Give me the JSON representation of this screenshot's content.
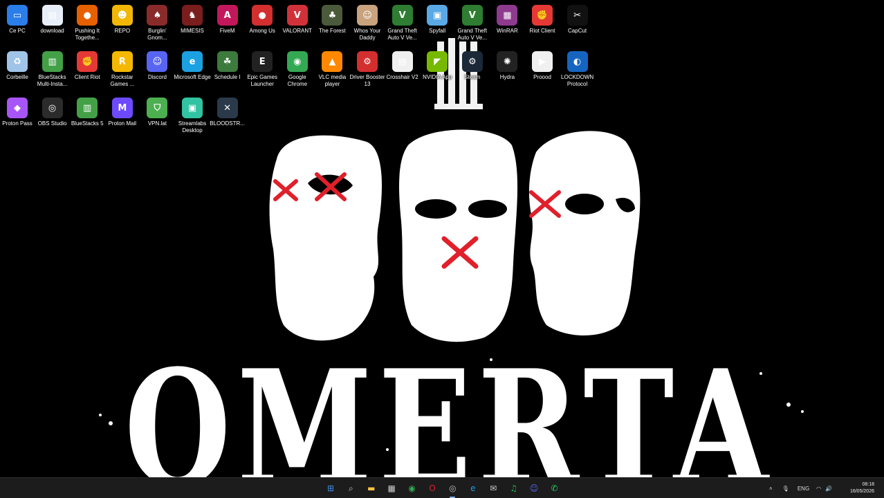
{
  "desktop": {
    "icons": [
      {
        "label": "Ce PC",
        "icon": "monitor-icon",
        "color": "#2b7de9",
        "glyph": "▭"
      },
      {
        "label": "download",
        "icon": "file-icon",
        "color": "#e8eef8",
        "glyph": "▤"
      },
      {
        "label": "Pushing It Togethe...",
        "icon": "firefox-icon",
        "color": "#e66000",
        "glyph": "●"
      },
      {
        "label": "REPO",
        "icon": "repo-icon",
        "color": "#f2b705",
        "glyph": "☻"
      },
      {
        "label": "Burglin' Gnom...",
        "icon": "gnome-icon",
        "color": "#8a2b2b",
        "glyph": "♠"
      },
      {
        "label": "MIMESIS",
        "icon": "mimesis-icon",
        "color": "#7a1d1d",
        "glyph": "♞"
      },
      {
        "label": "FiveM",
        "icon": "fivem-icon",
        "color": "#c2185b",
        "glyph": "A"
      },
      {
        "label": "Among Us",
        "icon": "among-us-icon",
        "color": "#d32f2f",
        "glyph": "●"
      },
      {
        "label": "VALORANT",
        "icon": "valorant-icon",
        "color": "#d13239",
        "glyph": "V"
      },
      {
        "label": "The Forest",
        "icon": "forest-icon",
        "color": "#4a5a3a",
        "glyph": "♣"
      },
      {
        "label": "Whos Your Daddy",
        "icon": "whos-your-daddy-icon",
        "color": "#c9a27e",
        "glyph": "☺"
      },
      {
        "label": "Grand Theft Auto V Ve...",
        "icon": "gta-icon",
        "color": "#2e7d32",
        "glyph": "V"
      },
      {
        "label": "Spyfall",
        "icon": "spyfall-icon",
        "color": "#5aa9e6",
        "glyph": "▣"
      },
      {
        "label": "Grand Theft Auto V Ve...",
        "icon": "gta-icon",
        "color": "#2e7d32",
        "glyph": "V"
      },
      {
        "label": "WinRAR",
        "icon": "winrar-icon",
        "color": "#8e3a8e",
        "glyph": "▦"
      },
      {
        "label": "Riot Client",
        "icon": "riot-client-icon",
        "color": "#e53935",
        "glyph": "✊"
      },
      {
        "label": "CapCut",
        "icon": "capcut-icon",
        "color": "#111111",
        "glyph": "✂"
      },
      {
        "label": "Corbeille",
        "icon": "recycle-bin-icon",
        "color": "#9fc4e8",
        "glyph": "♻"
      },
      {
        "label": "BlueStacks Multi-Insta...",
        "icon": "bluestacks-multi-icon",
        "color": "#43a047",
        "glyph": "▥"
      },
      {
        "label": "Client Riot",
        "icon": "riot-client-icon",
        "color": "#e53935",
        "glyph": "✊"
      },
      {
        "label": "Rockstar Games ...",
        "icon": "rockstar-icon",
        "color": "#f5b800",
        "glyph": "R"
      },
      {
        "label": "Discord",
        "icon": "discord-icon",
        "color": "#5865f2",
        "glyph": "☺"
      },
      {
        "label": "Microsoft Edge",
        "icon": "edge-icon",
        "color": "#1ba1e2",
        "glyph": "e"
      },
      {
        "label": "Schedule I",
        "icon": "schedule-icon",
        "color": "#3d7a3d",
        "glyph": "☘"
      },
      {
        "label": "Epic Games Launcher",
        "icon": "epic-games-icon",
        "color": "#222222",
        "glyph": "E"
      },
      {
        "label": "Google Chrome",
        "icon": "chrome-icon",
        "color": "#34a853",
        "glyph": "◉"
      },
      {
        "label": "VLC media player",
        "icon": "vlc-icon",
        "color": "#ff8800",
        "glyph": "▲"
      },
      {
        "label": "Driver Booster 13",
        "icon": "driver-booster-icon",
        "color": "#d32f2f",
        "glyph": "⚙"
      },
      {
        "label": "Crosshair V2",
        "icon": "file-icon",
        "color": "#f0f0f0",
        "glyph": "▤"
      },
      {
        "label": "NVIDIA App",
        "icon": "nvidia-icon",
        "color": "#76b900",
        "glyph": "◤"
      },
      {
        "label": "Steam",
        "icon": "steam-icon",
        "color": "#1b2838",
        "glyph": "⚙"
      },
      {
        "label": "Hydra",
        "icon": "hydra-icon",
        "color": "#222222",
        "glyph": "✺"
      },
      {
        "label": "Proood",
        "icon": "file-icon",
        "color": "#f0f0f0",
        "glyph": "▶"
      },
      {
        "label": "LOCKDOWN Protocol",
        "icon": "lockdown-icon",
        "color": "#1565c0",
        "glyph": "◐"
      },
      {
        "label": "Proton Pass",
        "icon": "proton-pass-icon",
        "color": "#a855f7",
        "glyph": "◆"
      },
      {
        "label": "OBS Studio",
        "icon": "obs-icon",
        "color": "#2b2b2b",
        "glyph": "◎"
      },
      {
        "label": "BlueStacks 5",
        "icon": "bluestacks-icon",
        "color": "#43a047",
        "glyph": "▥"
      },
      {
        "label": "Proton Mail",
        "icon": "proton-mail-icon",
        "color": "#6d4aff",
        "glyph": "M"
      },
      {
        "label": "VPN.lat",
        "icon": "vpn-icon",
        "color": "#4caf50",
        "glyph": "⛉"
      },
      {
        "label": "Streamlabs Desktop",
        "icon": "streamlabs-icon",
        "color": "#31c3a2",
        "glyph": "▣"
      },
      {
        "label": "BLOODSTR...",
        "icon": "bloodstrike-icon",
        "color": "#2a3a4a",
        "glyph": "✕"
      }
    ]
  },
  "wallpaper": {
    "text": "OMERTA",
    "accent": "#e0202a"
  },
  "taskbar": {
    "apps": [
      {
        "icon": "windows-start-icon",
        "color": "#3b8eea",
        "glyph": "⊞",
        "label": "Start"
      },
      {
        "icon": "search-icon",
        "color": "#cccccc",
        "glyph": "⌕",
        "label": "Search"
      },
      {
        "icon": "file-explorer-icon",
        "color": "#f6c343",
        "glyph": "▬",
        "label": "File Explorer"
      },
      {
        "icon": "store-icon",
        "color": "#cccccc",
        "glyph": "▦",
        "label": "Store"
      },
      {
        "icon": "chrome-icon",
        "color": "#34a853",
        "glyph": "◉",
        "label": "Chrome"
      },
      {
        "icon": "opera-icon",
        "color": "#e0202a",
        "glyph": "O",
        "label": "Opera"
      },
      {
        "icon": "obs-icon",
        "color": "#bbbbbb",
        "glyph": "◎",
        "label": "OBS"
      },
      {
        "icon": "edge-icon",
        "color": "#1ba1e2",
        "glyph": "e",
        "label": "Edge"
      },
      {
        "icon": "mail-icon",
        "color": "#cccccc",
        "glyph": "✉",
        "label": "Mail"
      },
      {
        "icon": "spotify-icon",
        "color": "#1db954",
        "glyph": "♫",
        "label": "Spotify"
      },
      {
        "icon": "discord-icon",
        "color": "#5865f2",
        "glyph": "☺",
        "label": "Discord"
      },
      {
        "icon": "whatsapp-icon",
        "color": "#25d366",
        "glyph": "✆",
        "label": "WhatsApp"
      }
    ],
    "tray": {
      "language": "ENG",
      "time": "08:18",
      "date": "16/05/2026"
    }
  }
}
